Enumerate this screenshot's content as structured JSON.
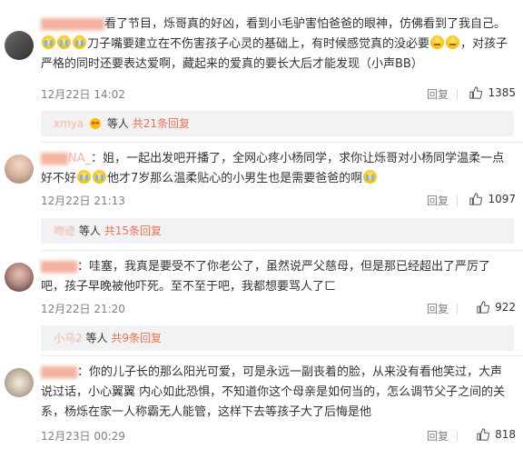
{
  "comments": [
    {
      "text1": "看了节目，烁哥真的好凶，看到小毛驴害怕爸爸的眼神，仿佛看到了我自己。",
      "text2": "刀子嘴要建立在不伤害孩子心灵的基础上，有时候感觉真的没必要",
      "text3": "，对孩子严格的同时还要表达爱啊，藏起来的爱真的要长大后才能发现（小声BB）",
      "time": "12月22日 14:02",
      "reply": "回复",
      "likes": "1385",
      "sub_user": "xmya",
      "sub_rest": "等人",
      "sub_count": "共21条回复"
    },
    {
      "user": "NA_",
      "text1": "：姐，一起出发吧开播了，全网心疼小杨同学，求你让烁哥对小杨同学温柔一点好不好",
      "text2": "他才7岁那么温柔贴心的小男生也是需要爸爸的啊",
      "time": "12月22日 21:13",
      "reply": "回复",
      "likes": "1097",
      "sub_user": "吻迹",
      "sub_rest": "等人",
      "sub_count": "共15条回复"
    },
    {
      "text1": "：哇塞，我真是要受不了你老公了，虽然说严父慈母，但是那已经超出了严厉了吧，孩子早晚被他吓死。至不至于吧，我都想要骂人了ㄈ",
      "time": "12月22日 21:20",
      "reply": "回复",
      "likes": "922",
      "sub_user": "小乌2",
      "sub_rest": "等人",
      "sub_count": "共9条回复"
    },
    {
      "text1": "：你的儿子长的那么阳光可爱，可是永远一副丧着的脸，从来没有看他笑过，大声说过话，小心翼翼 内心如此恐惧，不知道你这个母亲是如何当的，怎么调节父子之间的关系，杨烁在家一人称霸无人能管，这样下去等孩子大了后悔是他",
      "time": "12月23日 00:29",
      "reply": "回复",
      "likes": "818"
    }
  ],
  "colors": {
    "accent": "#eb7350",
    "meta": "#808080",
    "subbar_bg": "#f2f2f5"
  },
  "icons": {
    "like": "thumb-up-icon",
    "emoji_cry": "cry-emoji-icon",
    "emoji_meh": "meh-emoji-icon",
    "heart": "heart-eyes-emoji-icon"
  }
}
